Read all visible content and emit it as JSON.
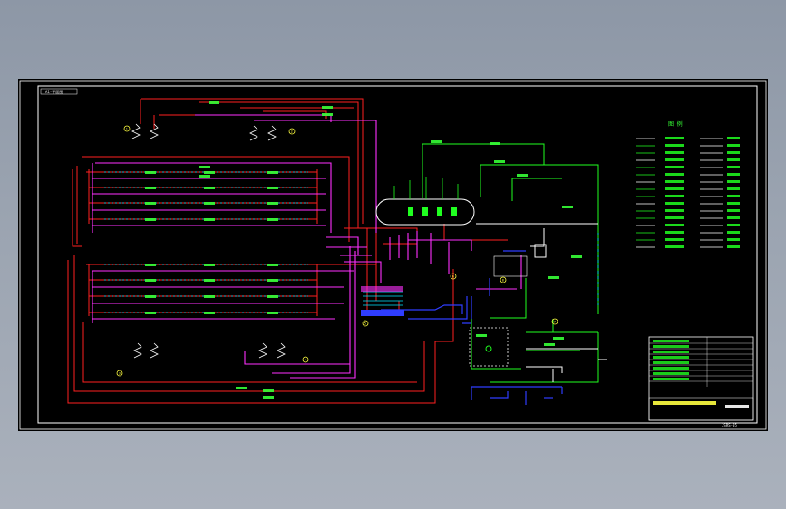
{
  "drawing": {
    "frame_tag": "A1-平面图",
    "legend_title": "图  例",
    "drawing_number": "JSRS-05",
    "colors": {
      "background": "#000000",
      "frame": "#ffffff",
      "hot_supply": "#ff2020",
      "hot_return": "#ff30ff",
      "cold_water": "#2f3dff",
      "steam": "#20ff20",
      "instrument": "#00e5ff",
      "text": "#36ff36"
    },
    "symbol_labels": [
      "1",
      "2",
      "3",
      "4",
      "5",
      "6",
      "7",
      "8"
    ],
    "legend_rows": 16,
    "title_block_rows": 8
  }
}
